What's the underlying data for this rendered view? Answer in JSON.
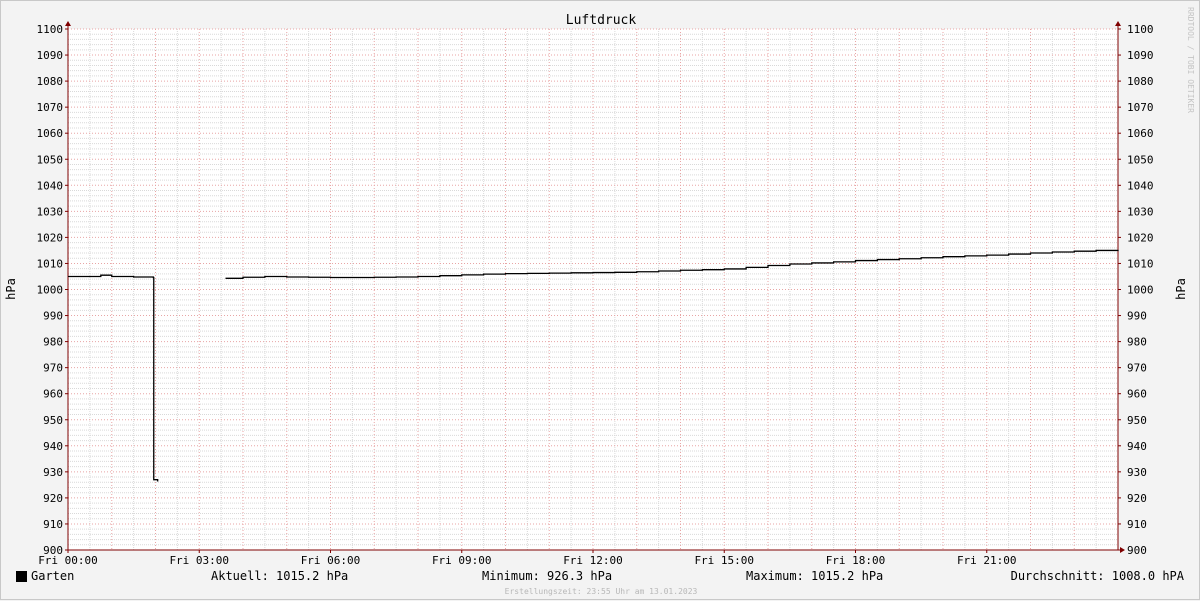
{
  "chart_data": {
    "type": "line",
    "title": "Luftdruck",
    "ylabel_left": "hPa",
    "ylabel_right": "hPa",
    "ylim": [
      900,
      1100
    ],
    "y_ticks": [
      900,
      910,
      920,
      930,
      940,
      950,
      960,
      970,
      980,
      990,
      1000,
      1010,
      1020,
      1030,
      1040,
      1050,
      1060,
      1070,
      1080,
      1090,
      1100
    ],
    "x_range_hours": [
      0,
      24
    ],
    "x_ticks": [
      {
        "hour": 0,
        "label": "Fri 00:00"
      },
      {
        "hour": 3,
        "label": "Fri 03:00"
      },
      {
        "hour": 6,
        "label": "Fri 06:00"
      },
      {
        "hour": 9,
        "label": "Fri 09:00"
      },
      {
        "hour": 12,
        "label": "Fri 12:00"
      },
      {
        "hour": 15,
        "label": "Fri 15:00"
      },
      {
        "hour": 18,
        "label": "Fri 18:00"
      },
      {
        "hour": 21,
        "label": "Fri 21:00"
      }
    ],
    "watermark": "RRDTOOL / TOBI OETIKER",
    "grid": true,
    "series": [
      {
        "name": "Garten",
        "color": "#000000",
        "segments": [
          [
            [
              0.0,
              1005.0
            ],
            [
              0.5,
              1005.0
            ],
            [
              0.75,
              1005.5
            ],
            [
              1.0,
              1005.0
            ],
            [
              1.5,
              1004.8
            ],
            [
              1.95,
              1004.6
            ],
            [
              1.96,
              927.0
            ],
            [
              2.05,
              926.3
            ]
          ],
          [
            [
              3.6,
              1004.3
            ],
            [
              4.0,
              1004.7
            ],
            [
              4.5,
              1005.0
            ],
            [
              5.0,
              1004.8
            ],
            [
              5.5,
              1004.7
            ],
            [
              6.0,
              1004.6
            ],
            [
              6.5,
              1004.6
            ],
            [
              7.0,
              1004.7
            ],
            [
              7.5,
              1004.8
            ],
            [
              8.0,
              1005.0
            ],
            [
              8.5,
              1005.3
            ],
            [
              9.0,
              1005.6
            ],
            [
              9.5,
              1005.9
            ],
            [
              10.0,
              1006.1
            ],
            [
              10.5,
              1006.2
            ],
            [
              11.0,
              1006.3
            ],
            [
              11.5,
              1006.4
            ],
            [
              12.0,
              1006.5
            ],
            [
              12.5,
              1006.6
            ],
            [
              13.0,
              1006.8
            ],
            [
              13.5,
              1007.1
            ],
            [
              14.0,
              1007.4
            ],
            [
              14.5,
              1007.6
            ],
            [
              15.0,
              1007.9
            ],
            [
              15.5,
              1008.5
            ],
            [
              16.0,
              1009.2
            ],
            [
              16.5,
              1009.8
            ],
            [
              17.0,
              1010.2
            ],
            [
              17.5,
              1010.6
            ],
            [
              18.0,
              1011.1
            ],
            [
              18.5,
              1011.5
            ],
            [
              19.0,
              1011.8
            ],
            [
              19.5,
              1012.2
            ],
            [
              20.0,
              1012.6
            ],
            [
              20.5,
              1012.9
            ],
            [
              21.0,
              1013.2
            ],
            [
              21.5,
              1013.6
            ],
            [
              22.0,
              1014.0
            ],
            [
              22.5,
              1014.4
            ],
            [
              23.0,
              1014.7
            ],
            [
              23.5,
              1015.0
            ],
            [
              24.0,
              1015.2
            ]
          ]
        ]
      }
    ]
  },
  "legend": {
    "series_label": "Garten",
    "swatch_color": "#000000"
  },
  "stats": {
    "current": "Aktuell: 1015.2 hPa",
    "minimum": "Minimum: 926.3 hPa",
    "maximum": "Maximum: 1015.2 hPa",
    "average": "Durchschnitt: 1008.0 hPA"
  },
  "footer": {
    "created": "Erstellungszeit: 23:55 Uhr am 13.01.2023"
  },
  "colors": {
    "background": "#f3f3f3",
    "plot_background": "#ffffff",
    "grid_minor": "#d9d9d9",
    "grid_major": "#e8a5a5",
    "axis": "#7f0000"
  }
}
